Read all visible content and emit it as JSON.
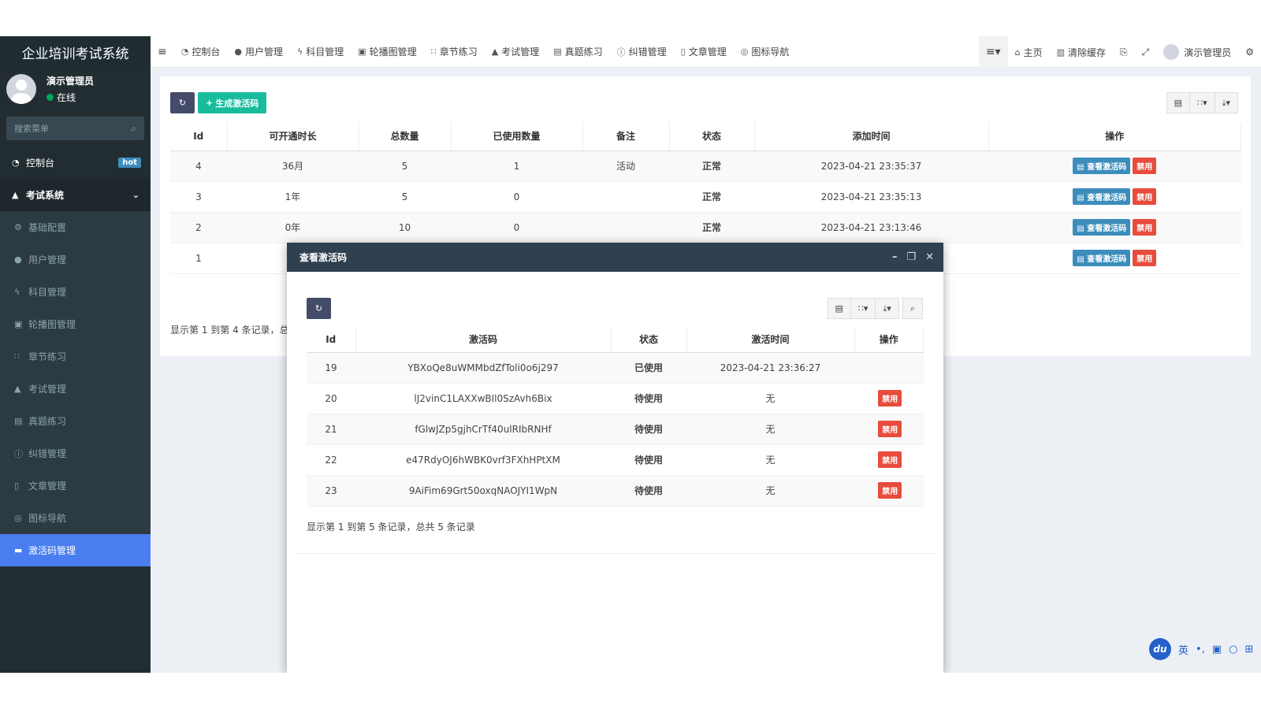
{
  "sidebar": {
    "brand": "企业培训考试系统",
    "user_name": "演示管理员",
    "user_status": "在线",
    "search_placeholder": "搜索菜单",
    "top_item": {
      "label": "控制台",
      "badge": "hot"
    },
    "section": {
      "label": "考试系统"
    },
    "items": [
      {
        "label": "基础配置"
      },
      {
        "label": "用户管理"
      },
      {
        "label": "科目管理"
      },
      {
        "label": "轮播图管理"
      },
      {
        "label": "章节练习"
      },
      {
        "label": "考试管理"
      },
      {
        "label": "真题练习"
      },
      {
        "label": "纠错管理"
      },
      {
        "label": "文章管理"
      },
      {
        "label": "图标导航"
      },
      {
        "label": "激活码管理"
      }
    ]
  },
  "topnav": {
    "items": [
      {
        "label": "控制台"
      },
      {
        "label": "用户管理"
      },
      {
        "label": "科目管理"
      },
      {
        "label": "轮播图管理"
      },
      {
        "label": "章节练习"
      },
      {
        "label": "考试管理"
      },
      {
        "label": "真题练习"
      },
      {
        "label": "纠错管理"
      },
      {
        "label": "文章管理"
      },
      {
        "label": "图标导航"
      }
    ],
    "home": "主页",
    "clear_cache": "清除缓存",
    "admin": "演示管理员"
  },
  "main": {
    "generate_label": "生成激活码",
    "columns": [
      "Id",
      "可开通时长",
      "总数量",
      "已使用数量",
      "备注",
      "状态",
      "添加时间",
      "操作"
    ],
    "rows": [
      {
        "id": "4",
        "duration": "36月",
        "total": "5",
        "used": "1",
        "remark": "活动",
        "status": "正常",
        "time": "2023-04-21 23:35:37"
      },
      {
        "id": "3",
        "duration": "1年",
        "total": "5",
        "used": "0",
        "remark": "",
        "status": "正常",
        "time": "2023-04-21 23:35:13"
      },
      {
        "id": "2",
        "duration": "0年",
        "total": "10",
        "used": "0",
        "remark": "",
        "status": "正常",
        "time": "2023-04-21 23:13:46"
      },
      {
        "id": "1",
        "duration": "",
        "total": "",
        "used": "",
        "remark": "",
        "status": "",
        "time": ""
      }
    ],
    "view_label": "查看激活码",
    "disable_label": "禁用",
    "pager_text": "显示第 1 到第 4 条记录，总共"
  },
  "modal": {
    "title": "查看激活码",
    "columns": [
      "Id",
      "激活码",
      "状态",
      "激活时间",
      "操作"
    ],
    "rows": [
      {
        "id": "19",
        "code": "YBXoQe8uWMMbdZfToli0o6j297",
        "status": "已使用",
        "time": "2023-04-21 23:36:27",
        "action": ""
      },
      {
        "id": "20",
        "code": "lJ2vinC1LAXXwBIl0SzAvh6Bix",
        "status": "待使用",
        "time": "无",
        "action": "禁用"
      },
      {
        "id": "21",
        "code": "fGlwJZp5gjhCrTf40ulRIbRNHf",
        "status": "待使用",
        "time": "无",
        "action": "禁用"
      },
      {
        "id": "22",
        "code": "e47RdyOJ6hWBK0vrf3FXhHPtXM",
        "status": "待使用",
        "time": "无",
        "action": "禁用"
      },
      {
        "id": "23",
        "code": "9AiFim69Grt50oxqNAOJYI1WpN",
        "status": "待使用",
        "time": "无",
        "action": "禁用"
      }
    ],
    "pager_text": "显示第 1 到第 5 条记录，总共 5 条记录"
  },
  "ime": {
    "logo": "du",
    "lang": "英"
  },
  "colors": {
    "sidebar_bg": "#222d32",
    "active": "#4a7ef0",
    "green": "#18bc9c",
    "primary": "#3c8dbc",
    "danger": "#e74c3c",
    "warning": "#f39c12"
  }
}
